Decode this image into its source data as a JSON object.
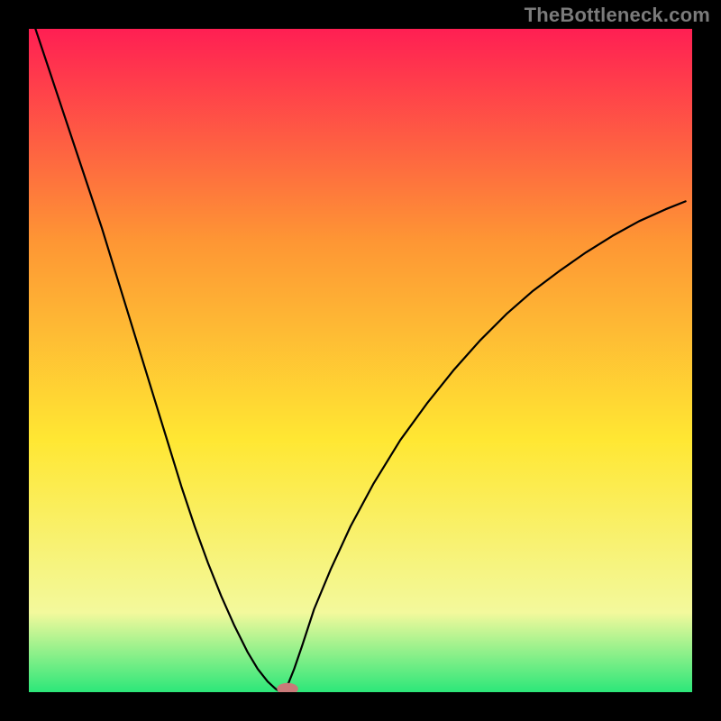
{
  "watermark": "TheBottleneck.com",
  "chart_data": {
    "type": "line",
    "title": "",
    "xlabel": "",
    "ylabel": "",
    "xlim": [
      0,
      100
    ],
    "ylim": [
      0,
      100
    ],
    "grid": false,
    "background_gradient": {
      "top": "#ff1f53",
      "upper_mid": "#fe9634",
      "mid": "#ffe733",
      "lower_mid": "#f3f99c",
      "bottom": "#2ce779"
    },
    "minimum_point": {
      "x": 38,
      "y": 0
    },
    "marker": {
      "x": 39,
      "y": 0.5,
      "rx": 1.6,
      "ry": 0.9,
      "color": "#c97a79"
    },
    "series": [
      {
        "name": "left-branch",
        "x": [
          1,
          3,
          5,
          7,
          9,
          11,
          13,
          15,
          17,
          19,
          21,
          23,
          25,
          27,
          29,
          31,
          33,
          34.5,
          36,
          37.2,
          38
        ],
        "y": [
          100,
          94,
          88,
          82,
          76,
          70,
          63.5,
          57,
          50.5,
          44,
          37.5,
          31,
          25,
          19.5,
          14.5,
          10,
          6,
          3.5,
          1.6,
          0.5,
          0
        ]
      },
      {
        "name": "right-branch",
        "x": [
          38,
          38.6,
          39.2,
          40,
          41.2,
          43,
          45.5,
          48.5,
          52,
          56,
          60,
          64,
          68,
          72,
          76,
          80,
          84,
          88,
          92,
          96,
          99
        ],
        "y": [
          0,
          0.5,
          1.5,
          3.5,
          7,
          12.5,
          18.5,
          25,
          31.5,
          38,
          43.5,
          48.5,
          53,
          57,
          60.5,
          63.5,
          66.3,
          68.8,
          71,
          72.8,
          74
        ]
      }
    ]
  }
}
